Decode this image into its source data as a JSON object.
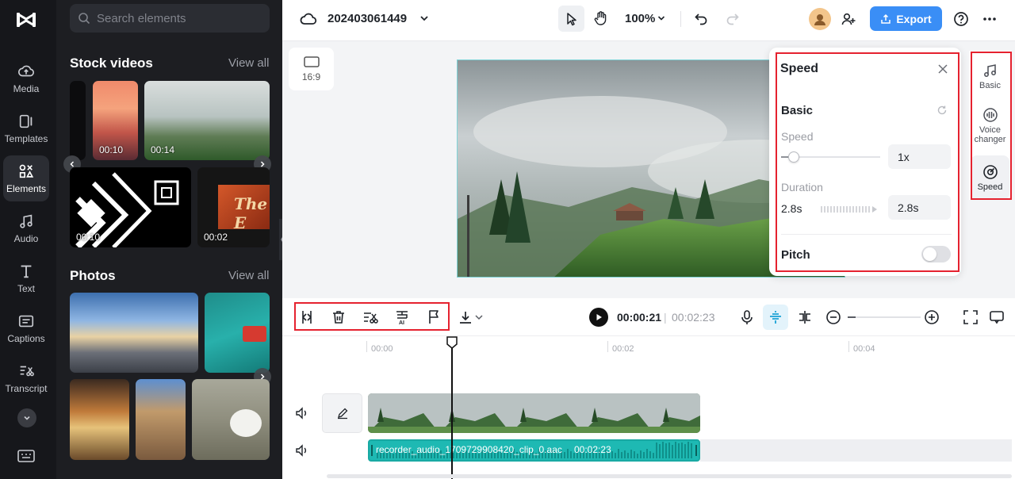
{
  "rail": {
    "items": [
      {
        "label": "Media",
        "icon": "cloud-upload-icon"
      },
      {
        "label": "Templates",
        "icon": "templates-icon"
      },
      {
        "label": "Elements",
        "icon": "elements-icon",
        "active": true
      },
      {
        "label": "Audio",
        "icon": "music-note-icon"
      },
      {
        "label": "Text",
        "icon": "text-icon"
      },
      {
        "label": "Captions",
        "icon": "captions-icon"
      },
      {
        "label": "Transcript",
        "icon": "transcript-icon"
      }
    ]
  },
  "library": {
    "search_placeholder": "Search elements",
    "stock_videos": {
      "title": "Stock videos",
      "view_all": "View all",
      "durations": [
        "00:10",
        "00:14",
        "00:10",
        "00:02"
      ],
      "thumb_text": "The E"
    },
    "photos": {
      "title": "Photos",
      "view_all": "View all"
    }
  },
  "topbar": {
    "project_name": "202403061449",
    "zoom": "100%",
    "export_label": "Export"
  },
  "canvas": {
    "aspect_ratio": "16:9"
  },
  "speed_panel": {
    "title": "Speed",
    "section": "Basic",
    "speed_label": "Speed",
    "speed_value": "1x",
    "speed_slider_fraction": 0.05,
    "duration_label": "Duration",
    "duration_original": "2.8s",
    "duration_value": "2.8s",
    "pitch_label": "Pitch",
    "pitch_on": false
  },
  "right_tools": {
    "items": [
      {
        "label": "Basic",
        "icon": "music-note-icon"
      },
      {
        "label": "Voice changer",
        "icon": "voice-changer-icon"
      },
      {
        "label": "Speed",
        "icon": "speed-gauge-icon",
        "active": true
      }
    ]
  },
  "timeline_toolbar": {
    "current_time": "00:00:21",
    "separator": "|",
    "total_time": "00:02:23"
  },
  "timeline": {
    "ticks": [
      "00:00",
      "00:02",
      "00:04"
    ],
    "audio_clip_label": "recorder_audio_1709729908420_clip_0.aac",
    "audio_clip_duration": "00:02:23"
  },
  "colors": {
    "accent": "#3a8ef6",
    "highlight": "#e5222f",
    "audio_clip": "#1eb9b3"
  }
}
